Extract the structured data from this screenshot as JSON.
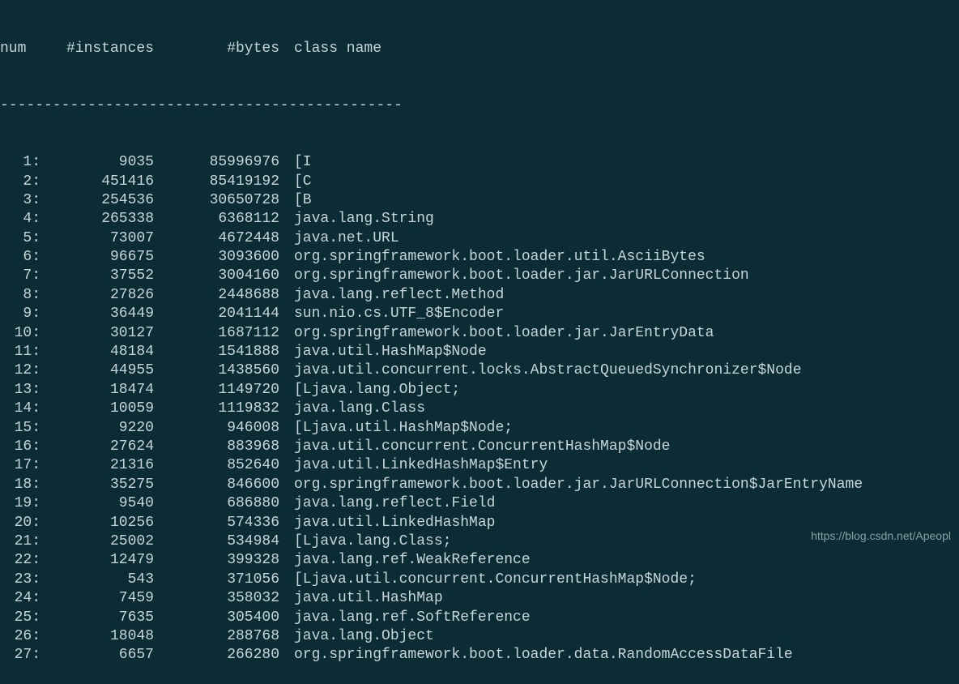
{
  "header": {
    "num": "num",
    "instances": "#instances",
    "bytes": "#bytes",
    "class_name": "class name"
  },
  "divider": "----------------------------------------------",
  "rows": [
    {
      "num": "1:",
      "instances": "9035",
      "bytes": "85996976",
      "class_name": "[I"
    },
    {
      "num": "2:",
      "instances": "451416",
      "bytes": "85419192",
      "class_name": "[C"
    },
    {
      "num": "3:",
      "instances": "254536",
      "bytes": "30650728",
      "class_name": "[B"
    },
    {
      "num": "4:",
      "instances": "265338",
      "bytes": "6368112",
      "class_name": "java.lang.String"
    },
    {
      "num": "5:",
      "instances": "73007",
      "bytes": "4672448",
      "class_name": "java.net.URL"
    },
    {
      "num": "6:",
      "instances": "96675",
      "bytes": "3093600",
      "class_name": "org.springframework.boot.loader.util.AsciiBytes"
    },
    {
      "num": "7:",
      "instances": "37552",
      "bytes": "3004160",
      "class_name": "org.springframework.boot.loader.jar.JarURLConnection"
    },
    {
      "num": "8:",
      "instances": "27826",
      "bytes": "2448688",
      "class_name": "java.lang.reflect.Method"
    },
    {
      "num": "9:",
      "instances": "36449",
      "bytes": "2041144",
      "class_name": "sun.nio.cs.UTF_8$Encoder"
    },
    {
      "num": "10:",
      "instances": "30127",
      "bytes": "1687112",
      "class_name": "org.springframework.boot.loader.jar.JarEntryData"
    },
    {
      "num": "11:",
      "instances": "48184",
      "bytes": "1541888",
      "class_name": "java.util.HashMap$Node"
    },
    {
      "num": "12:",
      "instances": "44955",
      "bytes": "1438560",
      "class_name": "java.util.concurrent.locks.AbstractQueuedSynchronizer$Node"
    },
    {
      "num": "13:",
      "instances": "18474",
      "bytes": "1149720",
      "class_name": "[Ljava.lang.Object;"
    },
    {
      "num": "14:",
      "instances": "10059",
      "bytes": "1119832",
      "class_name": "java.lang.Class"
    },
    {
      "num": "15:",
      "instances": "9220",
      "bytes": "946008",
      "class_name": "[Ljava.util.HashMap$Node;"
    },
    {
      "num": "16:",
      "instances": "27624",
      "bytes": "883968",
      "class_name": "java.util.concurrent.ConcurrentHashMap$Node"
    },
    {
      "num": "17:",
      "instances": "21316",
      "bytes": "852640",
      "class_name": "java.util.LinkedHashMap$Entry"
    },
    {
      "num": "18:",
      "instances": "35275",
      "bytes": "846600",
      "class_name": "org.springframework.boot.loader.jar.JarURLConnection$JarEntryName"
    },
    {
      "num": "19:",
      "instances": "9540",
      "bytes": "686880",
      "class_name": "java.lang.reflect.Field"
    },
    {
      "num": "20:",
      "instances": "10256",
      "bytes": "574336",
      "class_name": "java.util.LinkedHashMap"
    },
    {
      "num": "21:",
      "instances": "25002",
      "bytes": "534984",
      "class_name": "[Ljava.lang.Class;"
    },
    {
      "num": "22:",
      "instances": "12479",
      "bytes": "399328",
      "class_name": "java.lang.ref.WeakReference"
    },
    {
      "num": "23:",
      "instances": "543",
      "bytes": "371056",
      "class_name": "[Ljava.util.concurrent.ConcurrentHashMap$Node;"
    },
    {
      "num": "24:",
      "instances": "7459",
      "bytes": "358032",
      "class_name": "java.util.HashMap"
    },
    {
      "num": "25:",
      "instances": "7635",
      "bytes": "305400",
      "class_name": "java.lang.ref.SoftReference"
    },
    {
      "num": "26:",
      "instances": "18048",
      "bytes": "288768",
      "class_name": "java.lang.Object"
    },
    {
      "num": "27:",
      "instances": "6657",
      "bytes": "266280",
      "class_name": "org.springframework.boot.loader.data.RandomAccessDataFile"
    }
  ],
  "watermark": "https://blog.csdn.net/Apeopl"
}
